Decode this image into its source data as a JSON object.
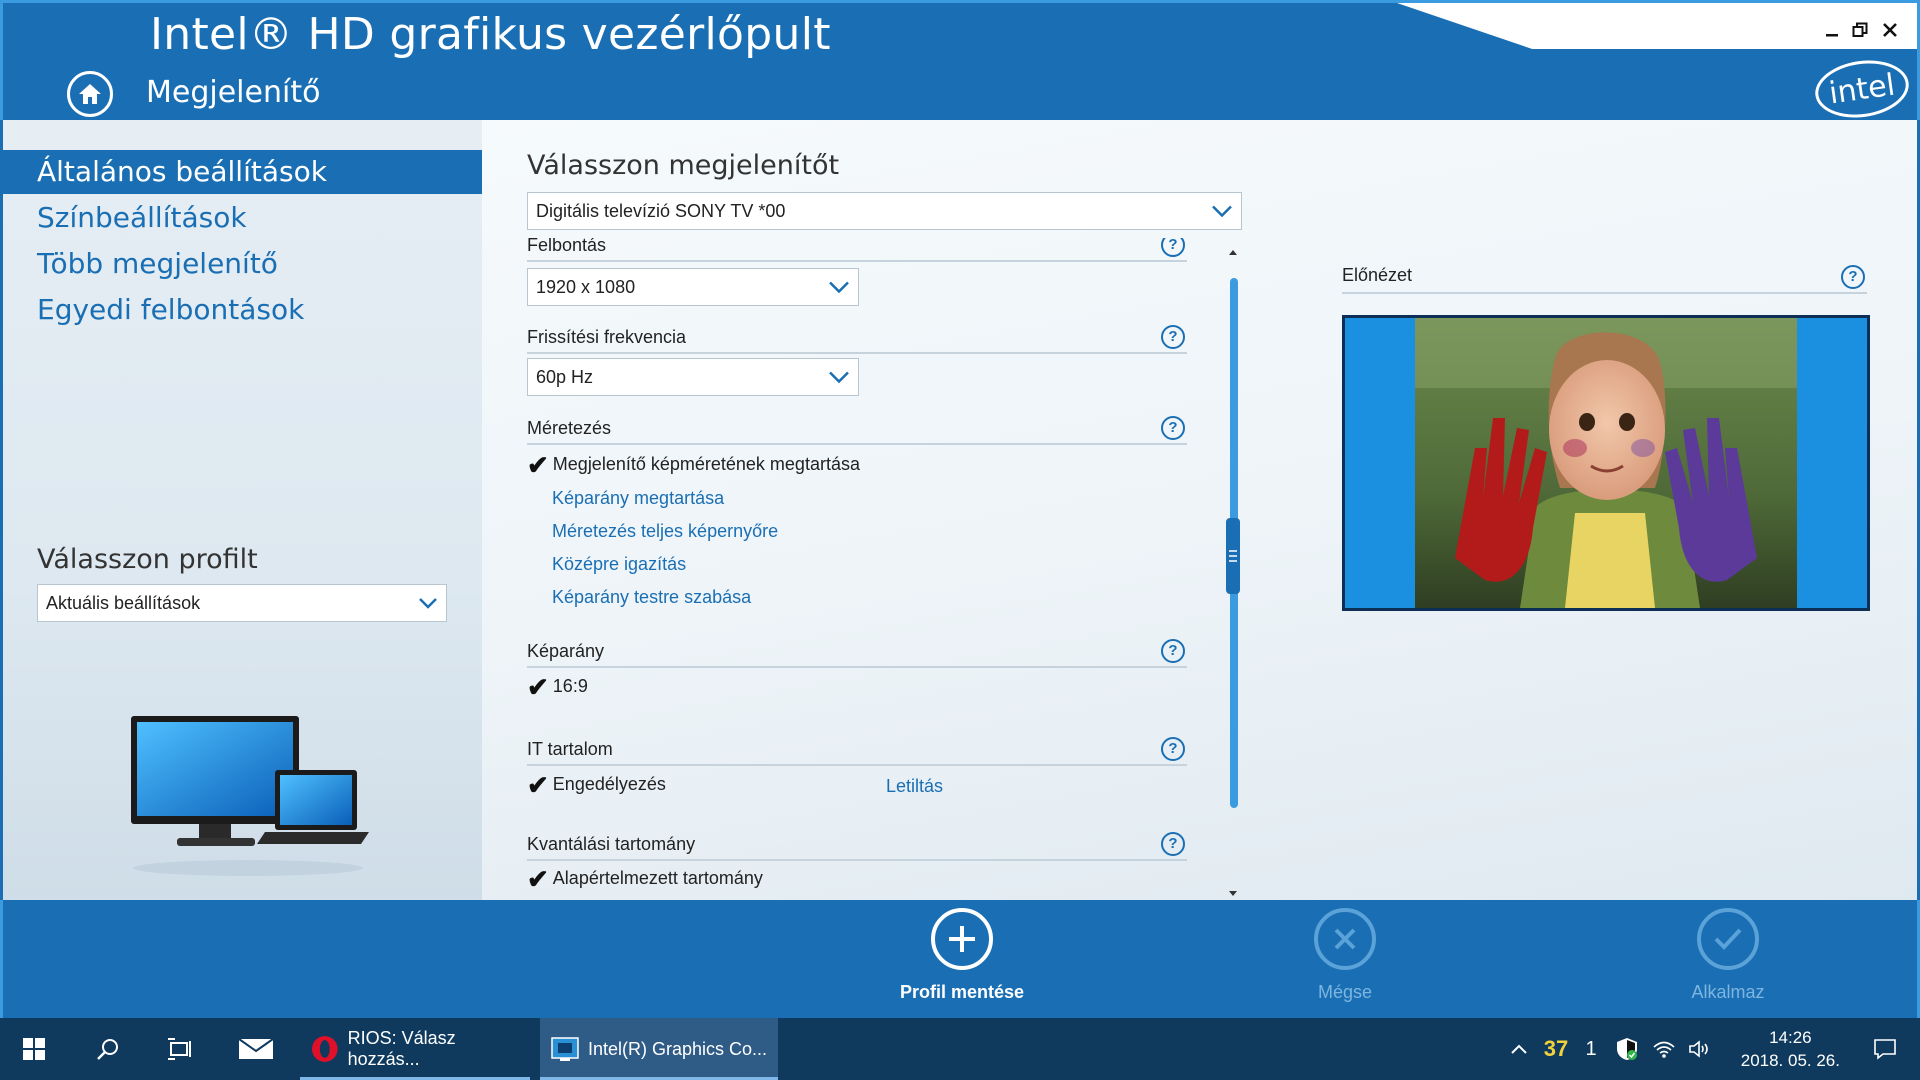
{
  "window": {
    "title": "Intel® HD grafikus vezérlőpult",
    "section": "Megjelenítő",
    "logo_text": "intel"
  },
  "sidebar": {
    "items": [
      {
        "label": "Általános beállítások",
        "active": true
      },
      {
        "label": "Színbeállítások",
        "active": false
      },
      {
        "label": "Több megjelenítő",
        "active": false
      },
      {
        "label": "Egyedi felbontások",
        "active": false
      }
    ],
    "profile_label": "Válasszon profilt",
    "profile_value": "Aktuális beállítások"
  },
  "main": {
    "display_label": "Válasszon megjelenítőt",
    "display_value": "Digitális televízió SONY TV  *00",
    "resolution": {
      "label": "Felbontás",
      "value": "1920 x 1080"
    },
    "refresh": {
      "label": "Frissítési frekvencia",
      "value": "60p Hz"
    },
    "scaling": {
      "label": "Méretezés",
      "checked": "Megjelenítő képméretének megtartása",
      "options": [
        "Képarány megtartása",
        "Méretezés teljes képernyőre",
        "Középre igazítás",
        "Képarány testre szabása"
      ]
    },
    "aspect": {
      "label": "Képarány",
      "checked": "16:9"
    },
    "it_content": {
      "label": "IT tartalom",
      "checked": "Engedélyezés",
      "other": "Letiltás"
    },
    "quant": {
      "label": "Kvantálási tartomány",
      "checked": "Alapértelmezett tartomány"
    },
    "help_glyph": "?",
    "check_glyph": "✔",
    "preview_label": "Előnézet"
  },
  "footer": {
    "save": "Profil mentése",
    "cancel": "Mégse",
    "apply": "Alkalmaz"
  },
  "taskbar": {
    "apps": [
      {
        "label": "RIOS: Válasz hozzás...",
        "icon": "opera-icon"
      },
      {
        "label": "Intel(R) Graphics Co...",
        "icon": "intel-graphics-icon"
      }
    ],
    "tray_number": "37",
    "tray_count": "1",
    "time": "14:26",
    "date": "2018. 05. 26."
  },
  "colors": {
    "accent": "#1a6fb4",
    "accent_light": "#3a9be0",
    "taskbar": "#0f3a5e"
  }
}
